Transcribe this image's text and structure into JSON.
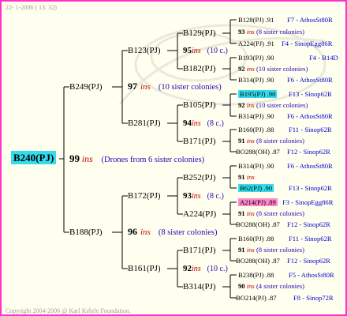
{
  "header": {
    "date_text": "22- 1-2006 ( 13: 32)"
  },
  "footer": {
    "copyright": "Copyright 2004-2006 @ Karl Kehrle Foundation."
  },
  "tree": {
    "root": "B240(PJ)",
    "root_num": "99",
    "root_ins": "ins",
    "root_note": "(Drones from 6 sister colonies)",
    "g1": [
      {
        "name": "B249(PJ)",
        "num": "97",
        "ins": "ins",
        "note": "(10 sister colonies)"
      },
      {
        "name": "B188(PJ)",
        "num": "96",
        "ins": "ins",
        "note": "(8 sister colonies)"
      }
    ],
    "g2": [
      {
        "name": "B123(PJ)",
        "num": "95",
        "ins": "ins",
        "note": "(10 c.)"
      },
      {
        "name": "B281(PJ)",
        "num": "94",
        "ins": "ins",
        "note": "(8 c.)"
      },
      {
        "name": "B172(PJ)",
        "num": "93",
        "ins": "ins",
        "note": "(8 c.)"
      },
      {
        "name": "B161(PJ)",
        "num": "92",
        "ins": "ins",
        "note": "(10 c.)"
      }
    ],
    "g3": [
      "B129(PJ)",
      "B182(PJ)",
      "B105(PJ)",
      "B171(PJ)",
      "B252(PJ)",
      "A224(PJ)",
      "B171(PJ)",
      "B314(PJ)"
    ],
    "leaves": [
      {
        "top": "B128(PJ) .91",
        "top_line": "F7 - AthosSt80R",
        "num": "93",
        "ins": "ins",
        "note": "(8 sister colonies)",
        "bot": "A224(PJ) .91",
        "bot_line": "F4 - SinopEgg86R"
      },
      {
        "top": "B193(PJ) .90",
        "top_line": "F4 - B14D",
        "num": "92",
        "ins": "ins",
        "note": "(10 sister colonies)",
        "bot": "B314(PJ) .90",
        "bot_line": "F6 - AthosSt80R"
      },
      {
        "top": "B195(PJ) .90",
        "top_line": "F13 - Sinop62R",
        "num": "92",
        "ins": "ins",
        "note": "(10 sister colonies)",
        "bot": "B314(PJ) .90",
        "bot_line": "F6 - AthosSt80R"
      },
      {
        "top": "B160(PJ) .88",
        "top_line": "F11 - Sinop62R",
        "num": "91",
        "ins": "ins",
        "note": "(8 sister colonies)",
        "bot": "BO288(OH) .87",
        "bot_line": "F12 - Sinop62R"
      },
      {
        "top": "B314(PJ) .90",
        "top_line": "F6 - AthosSt80R",
        "num": "91",
        "ins": "ins",
        "note": "",
        "bot": "B62(PJ) .90",
        "bot_line": "F13 - Sinop62R"
      },
      {
        "top": "A214(PJ) .89",
        "top_line": "F3 - SinopEgg86R",
        "num": "91",
        "ins": "ins",
        "note": "(8 sister colonies)",
        "bot": "BO288(OH) .87",
        "bot_line": "F12 - Sinop62R"
      },
      {
        "top": "B160(PJ) .88",
        "top_line": "F11 - Sinop62R",
        "num": "91",
        "ins": "ins",
        "note": "(8 sister colonies)",
        "bot": "BO288(OH) .87",
        "bot_line": "F12 - Sinop62R"
      },
      {
        "top": "B238(PJ) .88",
        "top_line": "F5 - AthosSt80R",
        "num": "90",
        "ins": "ins",
        "note": "(4 sister colonies)",
        "bot": "BO214(PJ) .87",
        "bot_line": "F8 - Sinop72R"
      }
    ]
  },
  "colors": {
    "frame": "#ff33cc",
    "highlight_cyan": "#33ddee",
    "highlight_pink": "#ff88cc",
    "ins": "#cc0000",
    "line_text": "#0000cc"
  }
}
